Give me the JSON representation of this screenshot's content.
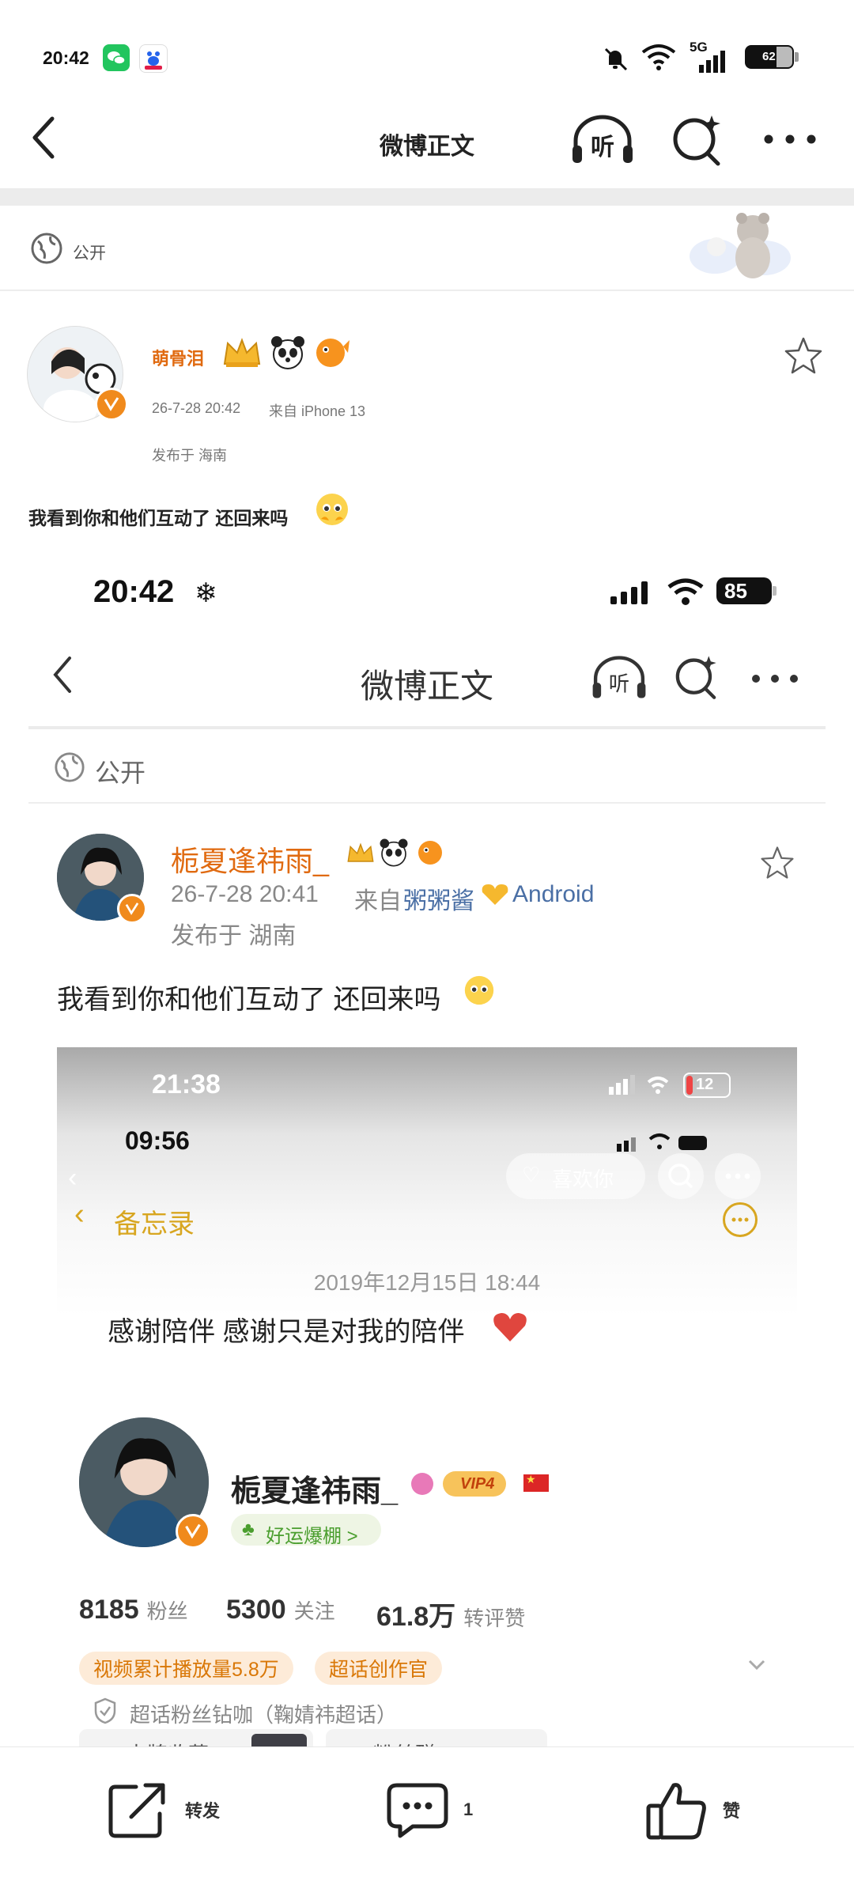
{
  "status_bar": {
    "time": "20:42",
    "network": "5G",
    "battery": "62"
  },
  "nav": {
    "title": "微博正文"
  },
  "post": {
    "visibility": "公开",
    "author": "萌骨泪",
    "timestamp": "26-7-28 20:42",
    "source": "来自 iPhone 13",
    "location": "发布于 海南",
    "text": "我看到你和他们互动了 还回来吗"
  },
  "screenshot1": {
    "time": "20:42",
    "battery": "85",
    "nav_title": "微博正文",
    "visibility": "公开",
    "author": "栀夏逢祎雨_",
    "timestamp": "26-7-28 20:41",
    "source_prefix": "来自",
    "source_device": "粥粥酱",
    "source_os": "Android",
    "location": "发布于 湖南",
    "text": "我看到你和他们互动了 还回来吗"
  },
  "screenshot2": {
    "time_outer": "21:38",
    "battery_outer": "12",
    "time_inner": "09:56",
    "like_button": "喜欢你",
    "memo_back": "备忘录",
    "memo_date": "2019年12月15日 18:44",
    "memo_text": "感谢陪伴 感谢只是对我的陪伴",
    "profile_name": "栀夏逢祎雨_",
    "vip_label": "VIP4",
    "luck_tag": "好运爆棚 >",
    "fans_count": "8185",
    "fans_label": "粉丝",
    "follow_count": "5300",
    "follow_label": "关注",
    "likes_count": "61.8万",
    "likes_label": "转评赞",
    "tag_video": "视频累计播放量5.8万",
    "tag_creator": "超话创作官",
    "fan_group": "超话粉丝钻咖（鞠婧祎超话）",
    "card_collect": "卡牌收藏",
    "card_fans": "粉丝群"
  },
  "bottom_bar": {
    "repost": "转发",
    "comment_count": "1",
    "like": "赞"
  },
  "colors": {
    "accent_orange": "#e06a10",
    "link_blue": "#4a6fa5",
    "background": "#ffffff"
  }
}
